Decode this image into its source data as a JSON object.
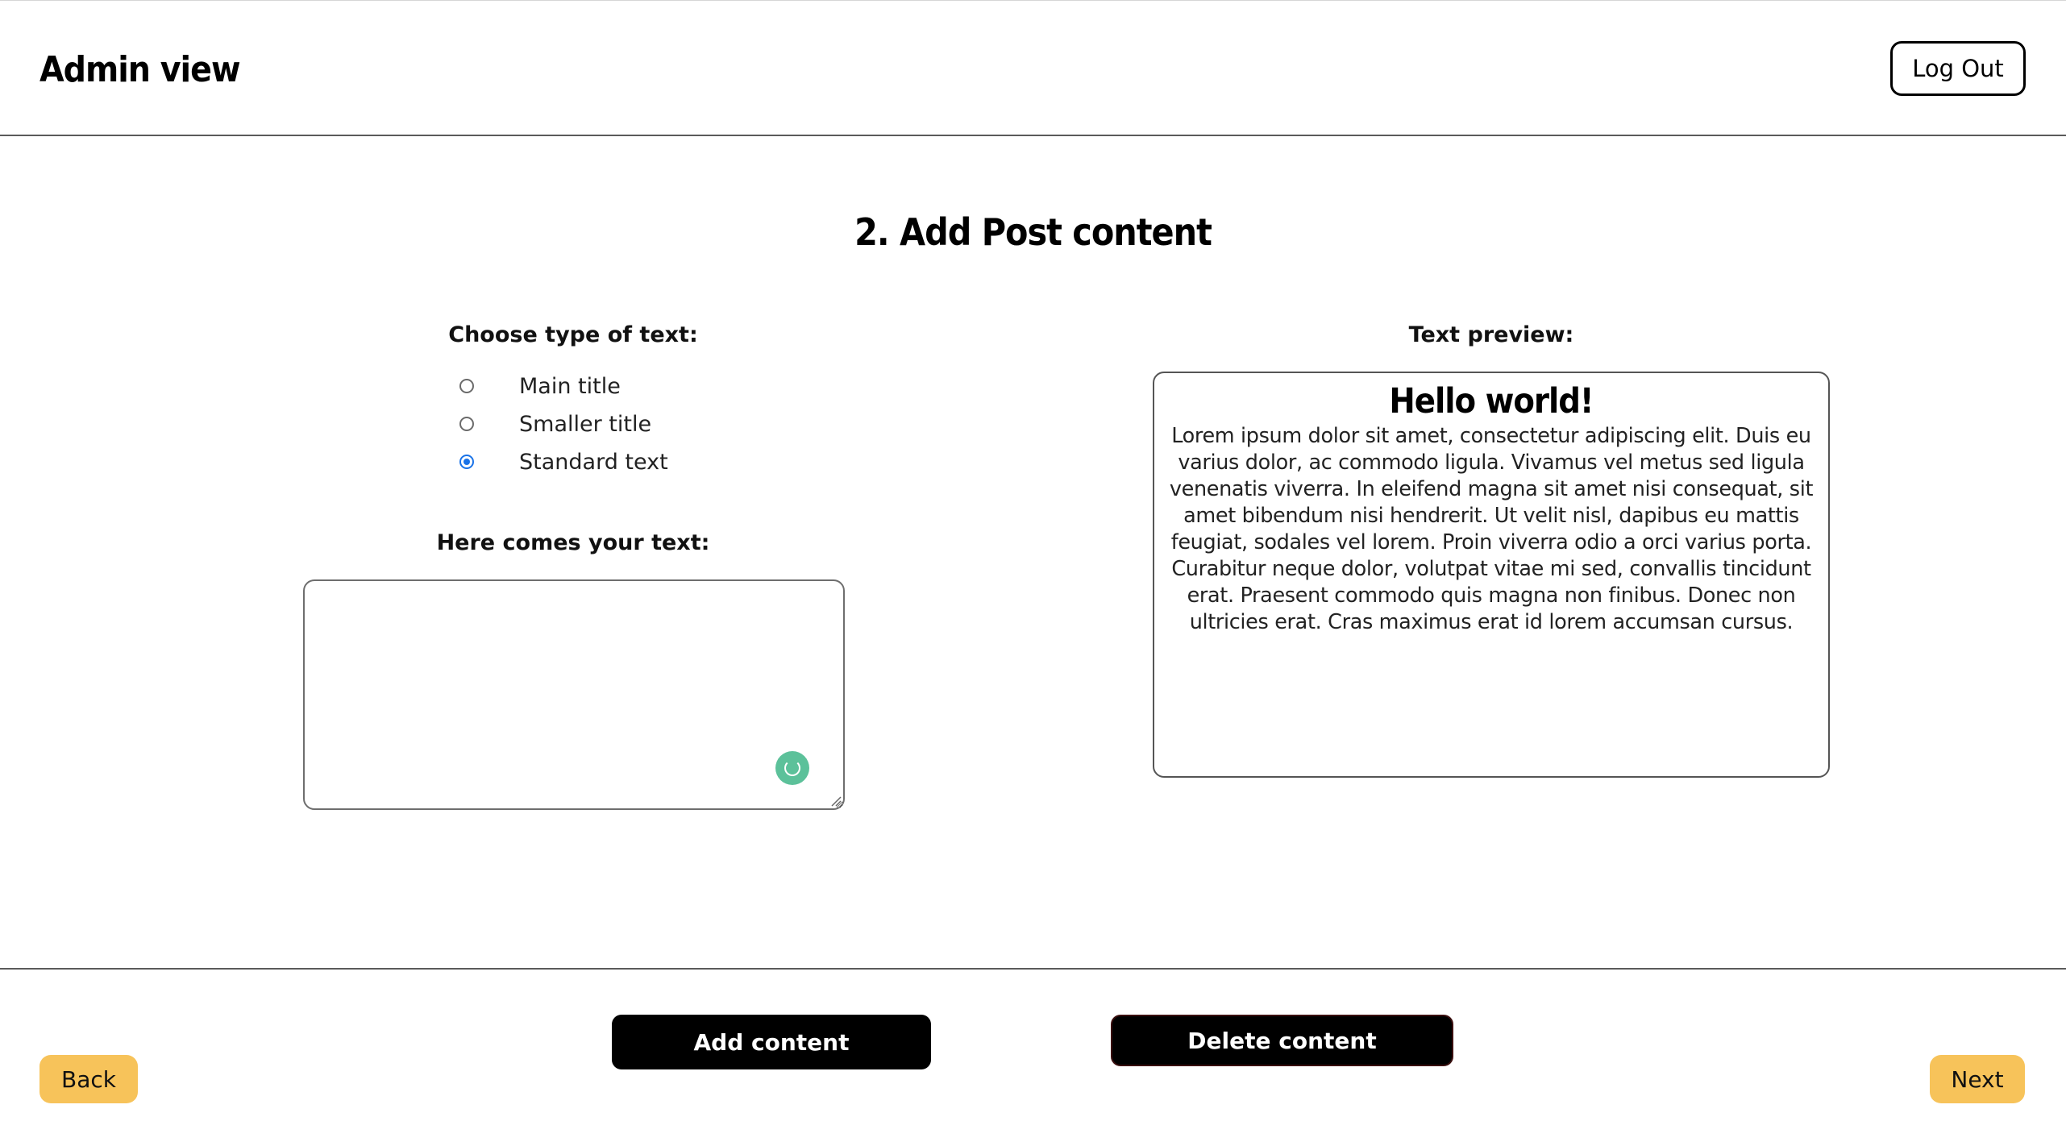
{
  "header": {
    "title": "Admin view",
    "logout_label": "Log Out"
  },
  "main": {
    "heading": "2. Add Post content",
    "text_type": {
      "label": "Choose type of text:",
      "options": [
        {
          "label": "Main title",
          "selected": false
        },
        {
          "label": "Smaller title",
          "selected": false
        },
        {
          "label": "Standard text",
          "selected": true
        }
      ]
    },
    "text_input": {
      "label": "Here comes your text:",
      "value": "",
      "placeholder": ""
    },
    "preview": {
      "label": "Text preview:",
      "title": "Hello world!",
      "body": "Lorem ipsum dolor sit amet, consectetur adipiscing elit. Duis eu varius dolor, ac commodo ligula. Vivamus vel metus sed ligula venenatis viverra. In eleifend magna sit amet nisi consequat, sit amet bibendum nisi hendrerit. Ut velit nisl, dapibus eu mattis feugiat, sodales vel lorem. Proin viverra odio a orci varius porta. Curabitur neque dolor, volutpat vitae mi sed, convallis tincidunt erat. Praesent commodo quis magna non finibus. Donec non ultricies erat. Cras maximus erat id lorem accumsan cursus."
    }
  },
  "footer": {
    "add_label": "Add content",
    "delete_label": "Delete content",
    "back_label": "Back",
    "next_label": "Next"
  },
  "colors": {
    "accent_yellow": "#f7c35a",
    "radio_selected": "#1a73e8",
    "assist_icon": "#5cc19a",
    "dark_button": "#000000"
  },
  "icons": {
    "text_assist": "grammar-assistant-icon",
    "resize": "resize-grip-icon"
  }
}
